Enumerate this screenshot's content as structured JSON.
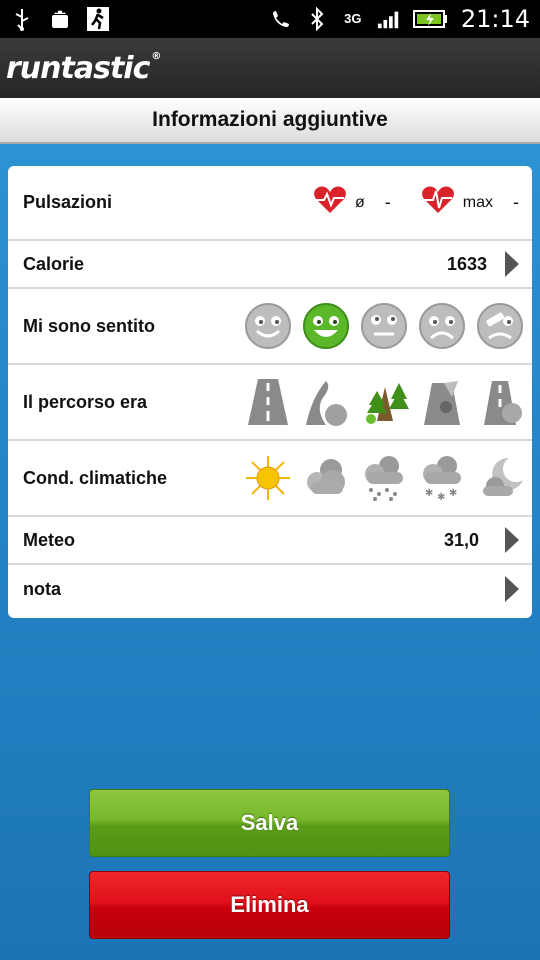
{
  "status_bar": {
    "time": "21:14",
    "network": "3G",
    "icons": [
      "usb-icon",
      "android-debug-icon",
      "runner-notification-icon",
      "phone-icon",
      "bluetooth-icon",
      "signal-icon",
      "battery-icon"
    ]
  },
  "app": {
    "logo": "runtastic",
    "logo_mark": "®"
  },
  "title": "Informazioni aggiuntive",
  "rows": {
    "pulse": {
      "label": "Pulsazioni",
      "avg_symbol": "ø",
      "avg_value": "-",
      "max_label": "max",
      "max_value": "-"
    },
    "calories": {
      "label": "Calorie",
      "value": "1633"
    },
    "feeling": {
      "label": "Mi sono sentito",
      "selected_index": 1,
      "options": [
        "face-smile-icon",
        "face-happy-icon",
        "face-neutral-icon",
        "face-sad-icon",
        "face-injured-icon"
      ]
    },
    "route": {
      "label": "Il percorso era",
      "options": [
        "road-icon",
        "hills-icon",
        "trees-icon",
        "trail-icon",
        "mixed-icon"
      ]
    },
    "weather": {
      "label": "Cond. climatiche",
      "options": [
        "sun-icon",
        "cloudy-icon",
        "rain-icon",
        "snow-icon",
        "night-icon"
      ]
    },
    "temperature": {
      "label": "Meteo",
      "value": "31,0"
    },
    "note": {
      "label": "nota"
    }
  },
  "buttons": {
    "save": "Salva",
    "delete": "Elimina"
  },
  "colors": {
    "accent_green": "#76b82a",
    "accent_red": "#e0111a",
    "background_blue": "#2a8fd0",
    "heart": "#d9222a"
  }
}
